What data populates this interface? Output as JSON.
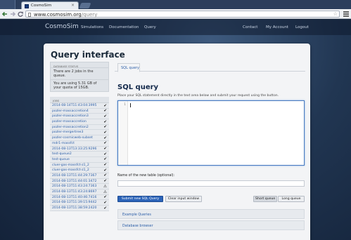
{
  "browser": {
    "tab_title": "CosmoSim",
    "tab_close": "×",
    "url_host": "www.cosmosim.org",
    "url_path": "/query"
  },
  "site": {
    "brand": "CosmoSim",
    "nav_left": [
      "Simulations",
      "Documentation",
      "Query"
    ],
    "nav_right": [
      "Contact",
      "My Account",
      "Logout"
    ]
  },
  "page": {
    "title": "Query interface"
  },
  "sidebar": {
    "status_header": "DATABASE STATUS",
    "queue_text": "There are 2 jobs in the queue.",
    "quota_text": "You are using 5.31 GB of your quota of 15GB.",
    "jobs_header": "JOBS",
    "jobs": [
      {
        "name": "2014-08-14T11:43:04:3995",
        "status": "✔"
      },
      {
        "name": "pozler-massaccretion4",
        "status": "✔"
      },
      {
        "name": "pozler-massaccretion3",
        "status": "✔"
      },
      {
        "name": "pozler-massaccretion",
        "status": "✔"
      },
      {
        "name": "pozler-massaccretion2",
        "status": "✔"
      },
      {
        "name": "pozler-mergertree3",
        "status": "✔"
      },
      {
        "name": "pozler-cosmicweb-subset",
        "status": "✔"
      },
      {
        "name": "mdr1-massfct",
        "status": "✔"
      },
      {
        "name": "2014-08-13T13:33:25:9296",
        "status": "✔"
      },
      {
        "name": "test-queue2",
        "status": "✔"
      },
      {
        "name": "test-queue",
        "status": "✔"
      },
      {
        "name": "cluer-gas-massfct-z1_2",
        "status": "✔"
      },
      {
        "name": "cluer-gas-massfct-z1_2",
        "status": "✔"
      },
      {
        "name": "2014-08-13T11:44:29:7367",
        "status": "✔"
      },
      {
        "name": "2014-08-13T11:44:01:3472",
        "status": "✔"
      },
      {
        "name": "2014-08-13T11:43:24:7363",
        "status": "⚠"
      },
      {
        "name": "2014-08-13T11:43:24:8697",
        "status": "⚠"
      },
      {
        "name": "2014-08-13T11:40:46:7416",
        "status": "✔"
      },
      {
        "name": "2014-08-13T11:39:15:9442",
        "status": "✔"
      },
      {
        "name": "2014-08-13T11:38:59:2420",
        "status": "✔"
      }
    ]
  },
  "main": {
    "tab_label": "SQL query",
    "heading": "SQL query",
    "instructions": "Place your SQL statement directly in the text area below and submit your request using the button.",
    "editor_line": "1",
    "table_name_label": "Name of the new table (optional):",
    "submit_label": "Submit new SQL Query",
    "clear_label": "Clear input window",
    "short_queue_label": "Short queue",
    "long_queue_label": "Long queue",
    "examples_label": "Example Queries",
    "browser_label": "Database browser"
  }
}
